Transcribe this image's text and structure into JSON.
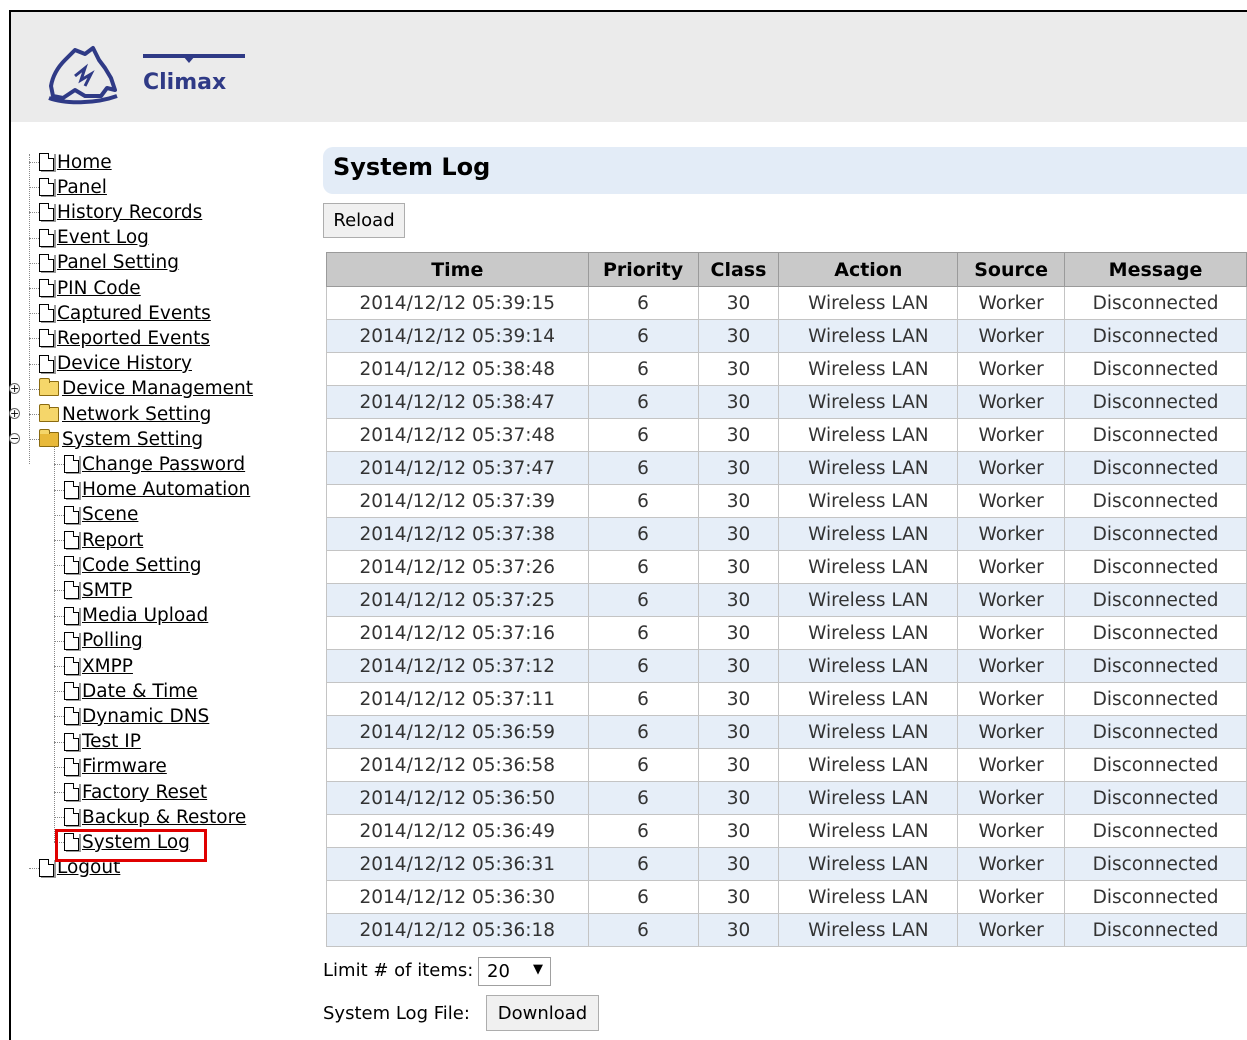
{
  "brand": {
    "name": "Climax"
  },
  "sidebar": {
    "items": [
      {
        "label": "Home"
      },
      {
        "label": "Panel"
      },
      {
        "label": "History Records"
      },
      {
        "label": "Event Log"
      },
      {
        "label": "Panel Setting"
      },
      {
        "label": "PIN Code"
      },
      {
        "label": "Captured Events"
      },
      {
        "label": "Reported Events"
      },
      {
        "label": "Device History"
      },
      {
        "label": "Device Management",
        "folder": true,
        "state": "collapsed"
      },
      {
        "label": "Network Setting",
        "folder": true,
        "state": "collapsed"
      },
      {
        "label": "System Setting",
        "folder": true,
        "state": "expanded"
      },
      {
        "label": "Logout"
      }
    ],
    "system_setting_children": [
      {
        "label": "Change Password"
      },
      {
        "label": "Home Automation"
      },
      {
        "label": "Scene"
      },
      {
        "label": "Report"
      },
      {
        "label": "Code Setting"
      },
      {
        "label": "SMTP"
      },
      {
        "label": "Media Upload"
      },
      {
        "label": "Polling"
      },
      {
        "label": "XMPP"
      },
      {
        "label": "Date & Time"
      },
      {
        "label": "Dynamic DNS"
      },
      {
        "label": "Test IP"
      },
      {
        "label": "Firmware"
      },
      {
        "label": "Factory Reset"
      },
      {
        "label": "Backup & Restore"
      },
      {
        "label": "System Log",
        "highlighted": true
      }
    ]
  },
  "main": {
    "title": "System Log",
    "reload_label": "Reload",
    "table": {
      "columns": [
        "Time",
        "Priority",
        "Class",
        "Action",
        "Source",
        "Message"
      ],
      "rows": [
        [
          "2014/12/12 05:39:15",
          "6",
          "30",
          "Wireless LAN",
          "Worker",
          "Disconnected"
        ],
        [
          "2014/12/12 05:39:14",
          "6",
          "30",
          "Wireless LAN",
          "Worker",
          "Disconnected"
        ],
        [
          "2014/12/12 05:38:48",
          "6",
          "30",
          "Wireless LAN",
          "Worker",
          "Disconnected"
        ],
        [
          "2014/12/12 05:38:47",
          "6",
          "30",
          "Wireless LAN",
          "Worker",
          "Disconnected"
        ],
        [
          "2014/12/12 05:37:48",
          "6",
          "30",
          "Wireless LAN",
          "Worker",
          "Disconnected"
        ],
        [
          "2014/12/12 05:37:47",
          "6",
          "30",
          "Wireless LAN",
          "Worker",
          "Disconnected"
        ],
        [
          "2014/12/12 05:37:39",
          "6",
          "30",
          "Wireless LAN",
          "Worker",
          "Disconnected"
        ],
        [
          "2014/12/12 05:37:38",
          "6",
          "30",
          "Wireless LAN",
          "Worker",
          "Disconnected"
        ],
        [
          "2014/12/12 05:37:26",
          "6",
          "30",
          "Wireless LAN",
          "Worker",
          "Disconnected"
        ],
        [
          "2014/12/12 05:37:25",
          "6",
          "30",
          "Wireless LAN",
          "Worker",
          "Disconnected"
        ],
        [
          "2014/12/12 05:37:16",
          "6",
          "30",
          "Wireless LAN",
          "Worker",
          "Disconnected"
        ],
        [
          "2014/12/12 05:37:12",
          "6",
          "30",
          "Wireless LAN",
          "Worker",
          "Disconnected"
        ],
        [
          "2014/12/12 05:37:11",
          "6",
          "30",
          "Wireless LAN",
          "Worker",
          "Disconnected"
        ],
        [
          "2014/12/12 05:36:59",
          "6",
          "30",
          "Wireless LAN",
          "Worker",
          "Disconnected"
        ],
        [
          "2014/12/12 05:36:58",
          "6",
          "30",
          "Wireless LAN",
          "Worker",
          "Disconnected"
        ],
        [
          "2014/12/12 05:36:50",
          "6",
          "30",
          "Wireless LAN",
          "Worker",
          "Disconnected"
        ],
        [
          "2014/12/12 05:36:49",
          "6",
          "30",
          "Wireless LAN",
          "Worker",
          "Disconnected"
        ],
        [
          "2014/12/12 05:36:31",
          "6",
          "30",
          "Wireless LAN",
          "Worker",
          "Disconnected"
        ],
        [
          "2014/12/12 05:36:30",
          "6",
          "30",
          "Wireless LAN",
          "Worker",
          "Disconnected"
        ],
        [
          "2014/12/12 05:36:18",
          "6",
          "30",
          "Wireless LAN",
          "Worker",
          "Disconnected"
        ]
      ]
    },
    "limit": {
      "label": "Limit # of items:",
      "value": "20"
    },
    "log_file": {
      "label": "System Log File:",
      "download_label": "Download"
    }
  },
  "colors": {
    "header_bg": "#ebebeb",
    "title_bar_bg": "#e3ecf7",
    "table_header_bg": "#c9c9c9",
    "row_alt_bg": "#e6eef8",
    "highlight_border": "#e00000",
    "brand_color": "#2f3a86"
  }
}
